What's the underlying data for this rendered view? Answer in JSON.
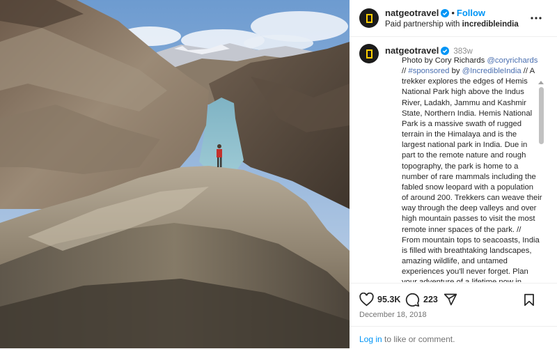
{
  "account": {
    "username": "natgeotravel",
    "follow_label": "Follow",
    "partnership_prefix": "Paid partnership with",
    "partner": "incredibleindia"
  },
  "caption": {
    "username": "natgeotravel",
    "age": "383w",
    "lines": [
      [
        {
          "t": "Photo by Cory Richards "
        },
        {
          "t": "@coryrichards",
          "link": true
        }
      ],
      [
        {
          "t": "// "
        },
        {
          "t": "#sponsored",
          "link": true
        },
        {
          "t": " by "
        },
        {
          "t": "@IncredibleIndia",
          "link": true
        },
        {
          "t": " // A"
        }
      ],
      [
        {
          "t": "trekker explores the edges of Hemis"
        }
      ],
      [
        {
          "t": "National Park high above the Indus"
        }
      ],
      [
        {
          "t": "River, Ladakh, Jammu and Kashmir"
        }
      ],
      [
        {
          "t": "State, Northern India. Hemis National"
        }
      ],
      [
        {
          "t": "Park is a massive swath of rugged"
        }
      ],
      [
        {
          "t": "terrain in the Himalaya and is the"
        }
      ],
      [
        {
          "t": "largest national park in India. Due in"
        }
      ],
      [
        {
          "t": "part to the remote nature and rough"
        }
      ],
      [
        {
          "t": "topography, the park is home to a"
        }
      ],
      [
        {
          "t": "number of rare mammals including the"
        }
      ],
      [
        {
          "t": "fabled snow leopard with a population"
        }
      ],
      [
        {
          "t": "of around 200. Trekkers can weave their"
        }
      ],
      [
        {
          "t": "way through the deep valleys and over"
        }
      ],
      [
        {
          "t": "high mountain passes to visit the most"
        }
      ],
      [
        {
          "t": "remote inner spaces of the park. //"
        }
      ],
      [
        {
          "t": "From mountain tops to seacoasts, India"
        }
      ],
      [
        {
          "t": "is filled with breathtaking landscapes,"
        }
      ],
      [
        {
          "t": "amazing wildlife, and untamed"
        }
      ],
      [
        {
          "t": "experiences you'll never forget. Plan"
        }
      ],
      [
        {
          "t": "your adventure of a lifetime now in"
        }
      ]
    ]
  },
  "stats": {
    "likes": "95.3K",
    "comments": "223"
  },
  "date": "December 18, 2018",
  "login": {
    "link_text": "Log in",
    "rest": " to like or comment."
  },
  "colors": {
    "link": "#0095f6",
    "mention": "#00376b",
    "verified": "#0095f6",
    "text": "#262626",
    "muted": "#737373"
  },
  "icons": [
    "verified-badge-icon",
    "more-options-icon",
    "heart-icon",
    "comment-icon",
    "share-icon",
    "bookmark-icon"
  ]
}
